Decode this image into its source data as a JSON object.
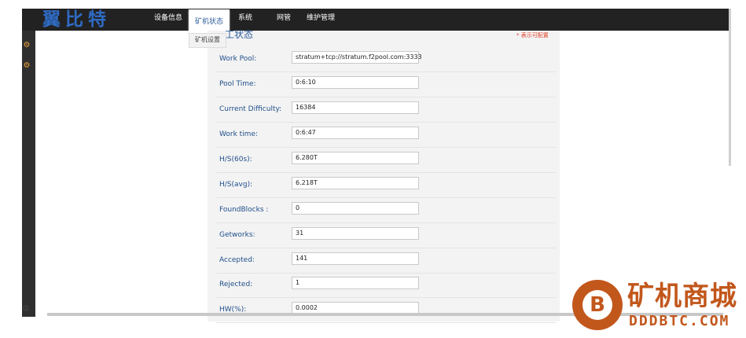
{
  "brand": {
    "logo_text": "翼比特"
  },
  "nav": {
    "device_info": "设备信息",
    "miner_status": "矿机状态",
    "system": "系统",
    "network": "网管",
    "maintenance": "维护管理"
  },
  "submenu": {
    "miner_settings": "矿机设置"
  },
  "panel": {
    "title": "工状态",
    "hint": "* 表示可配置",
    "rows": [
      {
        "label": "Work Pool:",
        "value": "stratum+tcp://stratum.f2pool.com:3333"
      },
      {
        "label": "Pool Time:",
        "value": "0:6:10"
      },
      {
        "label": "Current Difficulty:",
        "value": "16384"
      },
      {
        "label": "Work time:",
        "value": "0:6:47"
      },
      {
        "label": "H/S(60s):",
        "value": "6.280T"
      },
      {
        "label": "H/S(avg):",
        "value": "6.218T"
      },
      {
        "label": "FoundBlocks :",
        "value": "0"
      },
      {
        "label": "Getworks:",
        "value": "31"
      },
      {
        "label": "Accepted:",
        "value": "141"
      },
      {
        "label": "Rejected:",
        "value": "1"
      },
      {
        "label": "HW(%):",
        "value": "0.0002"
      }
    ]
  },
  "watermark": {
    "title": "矿机商城",
    "subtitle": "DDDBTC.COM",
    "badge": "B"
  },
  "colors": {
    "accent": "#2e5d9c",
    "topbar": "#222222",
    "watermark": "#c2571c"
  }
}
